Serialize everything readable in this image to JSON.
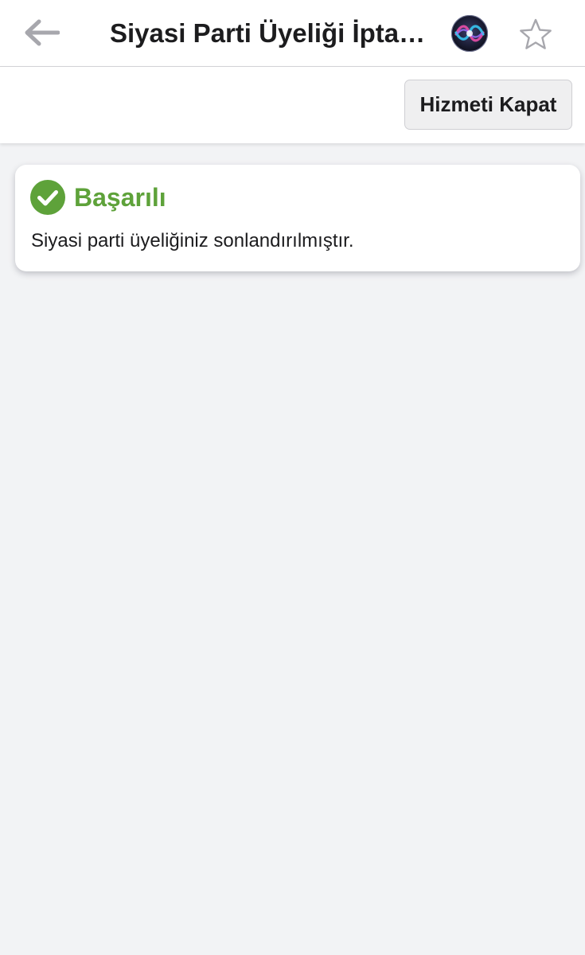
{
  "nav": {
    "title": "Siyasi Parti Üyeliği İpta…",
    "icons": {
      "back": "arrow-left-icon",
      "assistant": "siri-icon",
      "favorite": "star-outline-icon"
    }
  },
  "toolbar": {
    "close_service_label": "Hizmeti Kapat"
  },
  "result": {
    "icon": "check-circle-icon",
    "heading": "Başarılı",
    "message": "Siyasi parti üyeliğiniz sonlandırılmıştır."
  },
  "colors": {
    "success": "#5ea23a",
    "background": "#f2f3f5",
    "icon_gray": "#a7a7ad"
  }
}
